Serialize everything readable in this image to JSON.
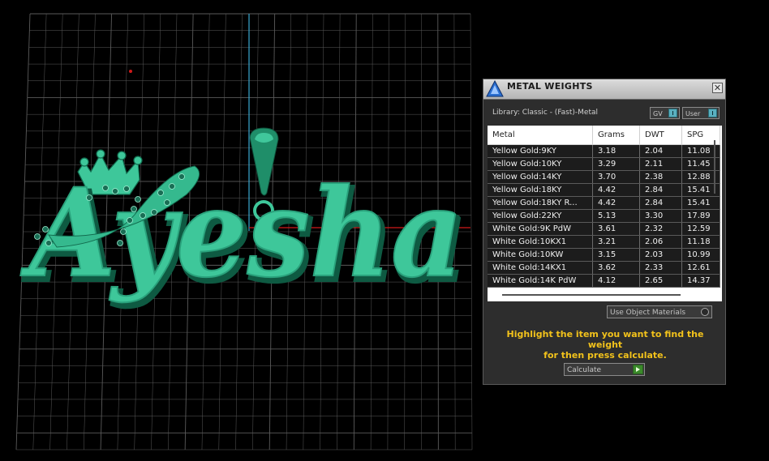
{
  "viewport": {
    "model_text": "Ayesha",
    "model_color": "#3ec79a",
    "grid_color": "#5a5a5a",
    "axis_y_color": "#3aa8d0",
    "axis_x_color": "#d01a1a"
  },
  "panel": {
    "title": "METAL WEIGHTS",
    "close_icon": "close-icon",
    "library_label": "Library: Classic - (Fast)-Metal",
    "toggles": {
      "gv": "GV",
      "user": "User"
    },
    "table": {
      "headers": {
        "metal": "Metal",
        "grams": "Grams",
        "dwt": "DWT",
        "spg": "SPG"
      },
      "rows": [
        {
          "metal": "Yellow Gold:9KY",
          "grams": "3.18",
          "dwt": "2.04",
          "spg": "11.08"
        },
        {
          "metal": "Yellow Gold:10KY",
          "grams": "3.29",
          "dwt": "2.11",
          "spg": "11.45"
        },
        {
          "metal": "Yellow Gold:14KY",
          "grams": "3.70",
          "dwt": "2.38",
          "spg": "12.88"
        },
        {
          "metal": "Yellow Gold:18KY",
          "grams": "4.42",
          "dwt": "2.84",
          "spg": "15.41"
        },
        {
          "metal": "Yellow Gold:18KY R...",
          "grams": "4.42",
          "dwt": "2.84",
          "spg": "15.41"
        },
        {
          "metal": "Yellow Gold:22KY",
          "grams": "5.13",
          "dwt": "3.30",
          "spg": "17.89"
        },
        {
          "metal": "White Gold:9K PdW",
          "grams": "3.61",
          "dwt": "2.32",
          "spg": "12.59"
        },
        {
          "metal": "White Gold:10KX1",
          "grams": "3.21",
          "dwt": "2.06",
          "spg": "11.18"
        },
        {
          "metal": "White Gold:10KW",
          "grams": "3.15",
          "dwt": "2.03",
          "spg": "10.99"
        },
        {
          "metal": "White Gold:14KX1",
          "grams": "3.62",
          "dwt": "2.33",
          "spg": "12.61"
        },
        {
          "metal": "White Gold:14K PdW",
          "grams": "4.12",
          "dwt": "2.65",
          "spg": "14.37"
        }
      ]
    },
    "use_object_materials": "Use Object Materials",
    "instructions_line1": "Highlight the item you want to find the weight",
    "instructions_line2": "for then press calculate.",
    "calculate_label": "Calculate",
    "instructions_color": "#f2c21b"
  }
}
